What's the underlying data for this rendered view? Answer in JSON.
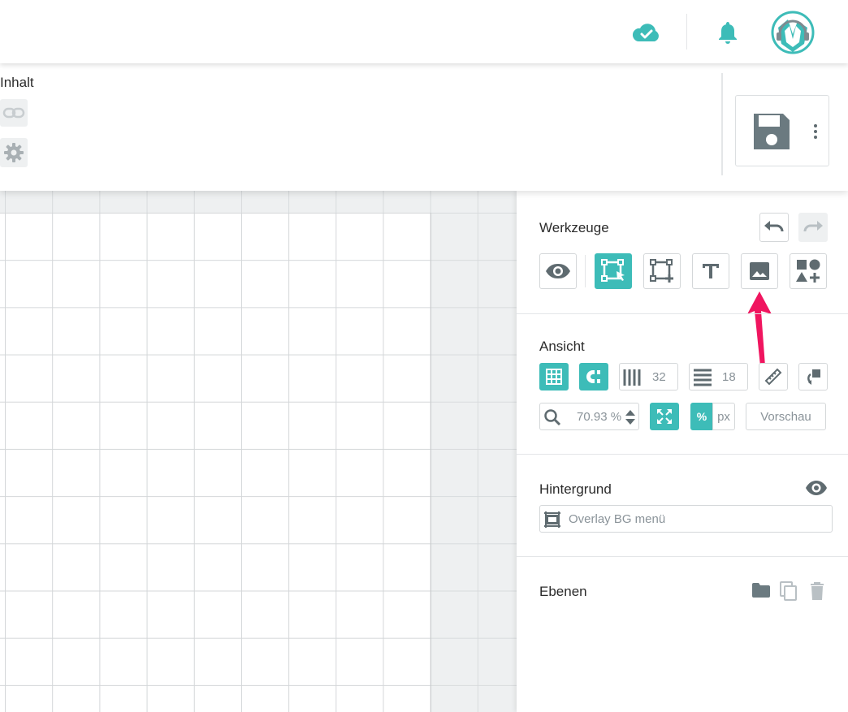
{
  "header": {
    "icons": [
      "cloud-check-icon",
      "bell-icon",
      "avatar-logo-icon"
    ],
    "accent_color": "#3dbcb8"
  },
  "toolbar": {
    "inhalt_label": "Inhalt",
    "icons": [
      "link-icon",
      "gear-icon",
      "save-icon",
      "more-vertical-icon"
    ]
  },
  "panel": {
    "werkzeuge": {
      "title": "Werkzeuge",
      "tools": [
        "eye-icon",
        "select-transform-icon",
        "add-frame-icon",
        "text-icon",
        "image-icon",
        "shapes-add-icon"
      ],
      "active_tool": "select-transform-icon"
    },
    "ansicht": {
      "title": "Ansicht",
      "columns_value": "32",
      "rows_value": "18",
      "zoom_value": "70.93 %",
      "unit_percent": "%",
      "unit_px": "px",
      "preview_label": "Vorschau"
    },
    "hintergrund": {
      "title": "Hintergrund",
      "select_value": "Overlay BG menü"
    },
    "ebenen": {
      "title": "Ebenen"
    }
  },
  "annotation": {
    "arrow_color": "#f0155f",
    "points_to": "image-icon"
  }
}
